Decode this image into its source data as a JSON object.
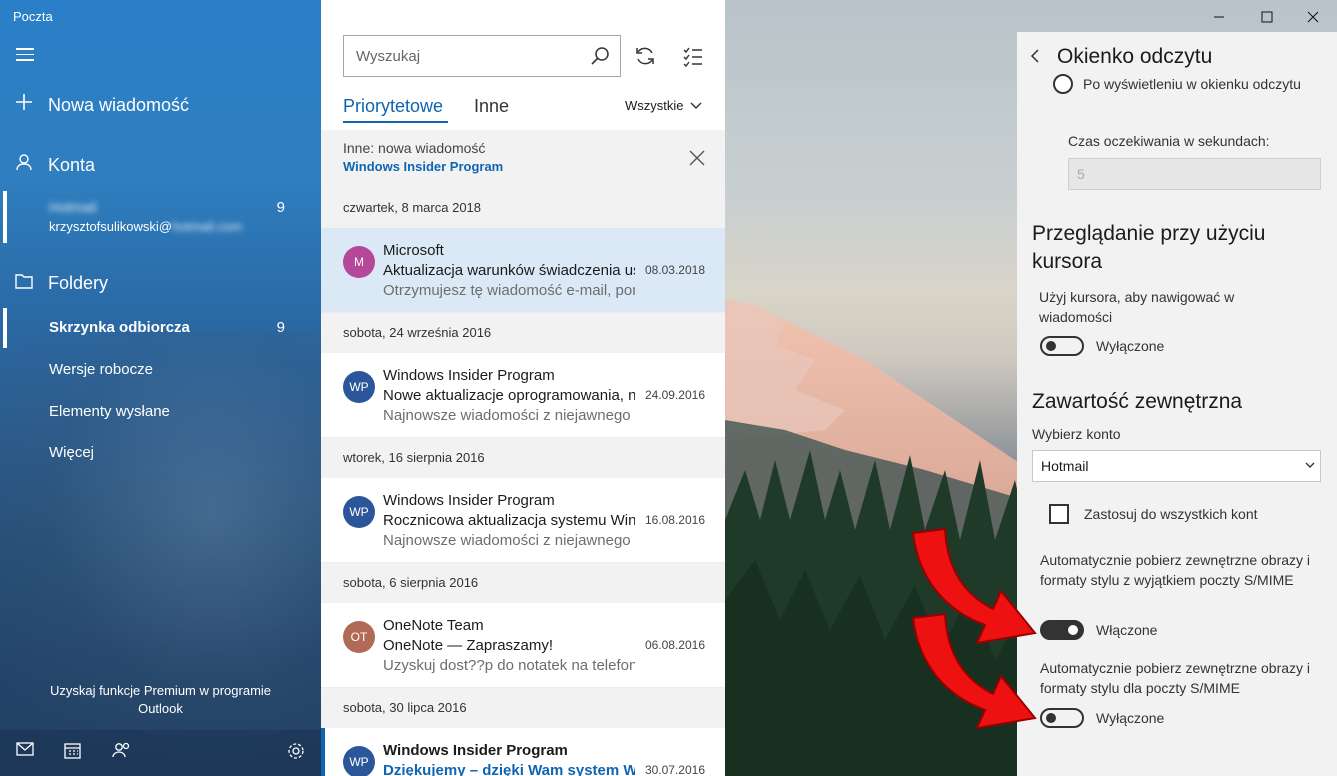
{
  "app": {
    "title": "Poczta"
  },
  "nav": {
    "new_message": "Nowa wiadomość",
    "accounts": "Konta",
    "account": {
      "name": "Hotmail",
      "email_prefix": "krzysztofsulikowski@",
      "email_domain": "hotmail.com",
      "count": "9"
    },
    "folders": "Foldery",
    "folder_items": [
      {
        "label": "Skrzynka odbiorcza",
        "count": "9"
      },
      {
        "label": "Wersje robocze"
      },
      {
        "label": "Elementy wysłane"
      },
      {
        "label": "Więcej"
      }
    ],
    "premium": "Uzyskaj funkcje Premium w programie Outlook"
  },
  "list": {
    "search_placeholder": "Wyszukaj",
    "tabs": [
      "Priorytetowe",
      "Inne"
    ],
    "filter": "Wszystkie",
    "notice": {
      "title": "Inne: nowa wiadomość",
      "sender": "Windows Insider Program"
    },
    "groups": [
      {
        "date": "czwartek, 8 marca 2018",
        "messages": [
          {
            "initials": "M",
            "color": "#b5489a",
            "from": "Microsoft",
            "subject": "Aktualizacja warunków świadczenia usług",
            "preview": "Otrzymujesz tę wiadomość e-mail, ponieważ",
            "date": "08.03.2018"
          }
        ]
      },
      {
        "date": "sobota, 24 września 2016",
        "messages": [
          {
            "initials": "WP",
            "color": "#2b579a",
            "from": "Windows Insider Program",
            "subject": "Nowe aktualizacje oprogramowania, nowe",
            "preview": "Najnowsze wiadomości z niejawnego programu",
            "date": "24.09.2016"
          }
        ]
      },
      {
        "date": "wtorek, 16 sierpnia 2016",
        "messages": [
          {
            "initials": "WP",
            "color": "#2b579a",
            "from": "Windows Insider Program",
            "subject": "Rocznicowa aktualizacja systemu Windows",
            "preview": "Najnowsze wiadomości z niejawnego programu",
            "date": "16.08.2016"
          }
        ]
      },
      {
        "date": "sobota, 6 sierpnia 2016",
        "messages": [
          {
            "initials": "OT",
            "color": "#b06a55",
            "from": "OneNote Team",
            "subject": "OneNote — Zapraszamy!",
            "preview": "Uzyskuj dost??p do notatek na telefonie",
            "date": "06.08.2016"
          }
        ]
      },
      {
        "date": "sobota, 30 lipca 2016",
        "messages": [
          {
            "initials": "WP",
            "color": "#2b579a",
            "from": "Windows Insider Program",
            "subject": "Dziękujemy – dzięki Wam system Windows",
            "preview": "",
            "date": "30.07.2016"
          }
        ]
      }
    ]
  },
  "flyout": {
    "title": "Okienko odczytu",
    "radio_label": "Po wyświetleniu w okienku odczytu",
    "timeout_label": "Czas oczekiwania w sekundach:",
    "timeout_value": "5",
    "cursor_heading": "Przeglądanie przy użyciu kursora",
    "cursor_desc": "Użyj kursora, aby nawigować w wiadomości",
    "cursor_toggle": "Wyłączone",
    "external_heading": "Zawartość zewnętrzna",
    "choose_account": "Wybierz konto",
    "account_value": "Hotmail",
    "apply_all": "Zastosuj do wszystkich kont",
    "auto_download_1": "Automatycznie pobierz zewnętrzne obrazy i formaty stylu z wyjątkiem poczty S/MIME",
    "auto_download_1_state": "Włączone",
    "auto_download_2": "Automatycznie pobierz zewnętrzne obrazy i formaty stylu dla poczty S/MIME",
    "auto_download_2_state": "Wyłączone"
  },
  "colors": {
    "accent": "#1065b3",
    "arrow": "#ee1111"
  }
}
